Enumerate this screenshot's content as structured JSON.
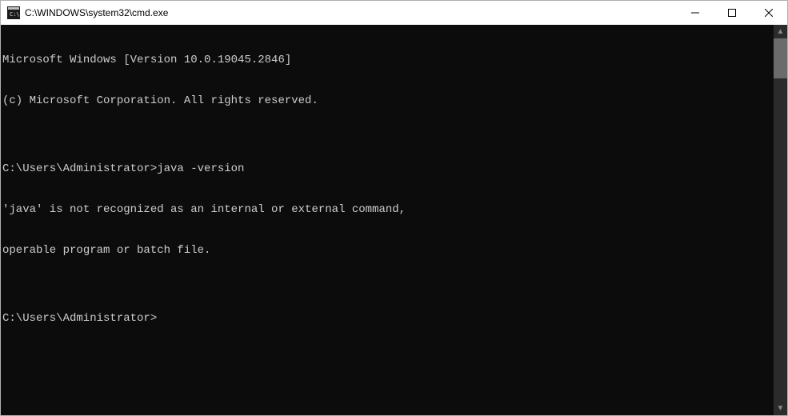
{
  "window": {
    "title": "C:\\WINDOWS\\system32\\cmd.exe"
  },
  "terminal": {
    "lines": [
      "Microsoft Windows [Version 10.0.19045.2846]",
      "(c) Microsoft Corporation. All rights reserved.",
      "",
      "C:\\Users\\Administrator>java -version",
      "'java' is not recognized as an internal or external command,",
      "operable program or batch file.",
      "",
      "C:\\Users\\Administrator>"
    ]
  }
}
